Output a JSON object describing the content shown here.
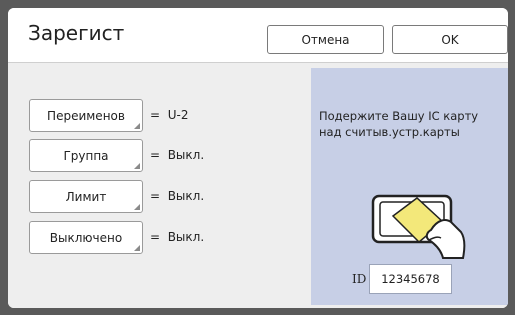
{
  "header": {
    "title": "Зарегист",
    "cancel_label": "Отмена",
    "ok_label": "OK"
  },
  "rows": [
    {
      "label": "Переименов",
      "value": "U-2"
    },
    {
      "label": "Группа",
      "value": "Выкл."
    },
    {
      "label": "Лимит",
      "value": "Выкл."
    },
    {
      "label": "Выключено",
      "value": "Выкл."
    }
  ],
  "equals": "=",
  "card_panel": {
    "message": "Подержите Вашу IC карту над считыв.устр.карты",
    "id_label": "ID",
    "id_value": "12345678",
    "icon": "card-reader-icon"
  },
  "colors": {
    "background": "#5a5a5a",
    "panel": "#c7cfe6",
    "card_fill": "#f3e87a"
  }
}
